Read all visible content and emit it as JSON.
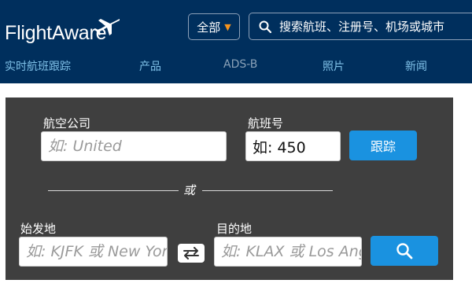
{
  "header": {
    "logo_text": "FlightAware",
    "scope_label": "全部",
    "search_placeholder": "搜索航班、注册号、机场或城市",
    "nav": [
      {
        "label": "实时航班跟踪"
      },
      {
        "label": "产品"
      },
      {
        "label": "ADS-B"
      },
      {
        "label": "照片"
      },
      {
        "label": "新闻"
      }
    ],
    "colors": {
      "background": "#002f5d",
      "link": "#7fc1e8",
      "accent": "#f7941d"
    }
  },
  "form": {
    "airline_label": "航空公司",
    "airline_placeholder": "如: United",
    "flight_label": "航班号",
    "flight_value": "如: 450",
    "track_button": "跟踪",
    "or_text": "或",
    "origin_label": "始发地",
    "origin_placeholder": "如: KJFK 或 New York",
    "destination_label": "目的地",
    "destination_placeholder": "如: KLAX 或 Los Angeles",
    "icons": {
      "swap": "swap-arrows-icon",
      "search": "search-icon"
    },
    "colors": {
      "panel": "#3f3f3f",
      "button": "#1a92e0"
    }
  }
}
